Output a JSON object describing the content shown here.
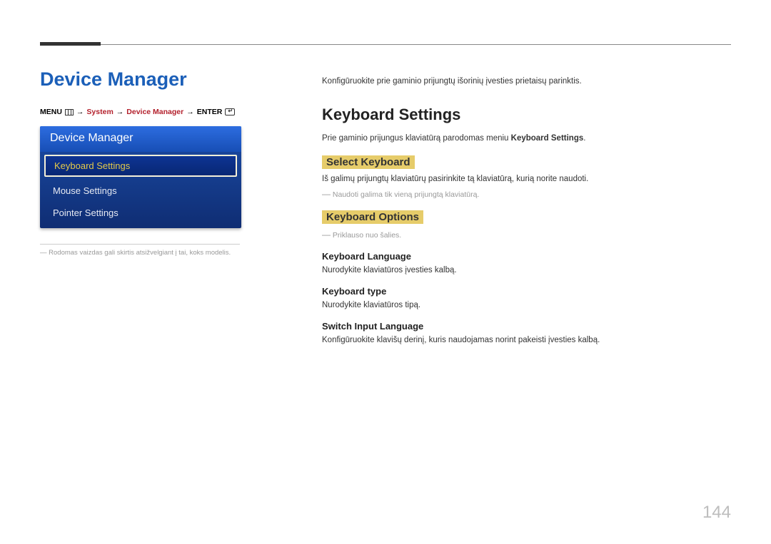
{
  "breadcrumb": {
    "menu": "MENU",
    "arrow": "→",
    "system": "System",
    "device_manager": "Device Manager",
    "enter": "ENTER"
  },
  "left": {
    "title": "Device Manager",
    "panel_header": "Device Manager",
    "items": [
      {
        "label": "Keyboard Settings",
        "selected": true
      },
      {
        "label": "Mouse Settings",
        "selected": false
      },
      {
        "label": "Pointer Settings",
        "selected": false
      }
    ],
    "footnote": "Rodomas vaizdas gali skirtis atsižvelgiant į tai, koks modelis."
  },
  "right": {
    "intro": "Konfigūruokite prie gaminio prijungtų išorinių įvesties prietaisų parinktis.",
    "h2": "Keyboard Settings",
    "h2_desc_pre": "Prie gaminio prijungus klaviatūrą parodomas meniu ",
    "h2_desc_bold": "Keyboard Settings",
    "h2_desc_post": ".",
    "select_keyboard": {
      "title": "Select Keyboard",
      "body": "Iš galimų prijungtų klaviatūrų pasirinkite tą klaviatūrą, kurią norite naudoti.",
      "note": "Naudoti galima tik vieną prijungtą klaviatūrą."
    },
    "keyboard_options": {
      "title": "Keyboard Options",
      "note": "Priklauso nuo šalies.",
      "lang_h": "Keyboard Language",
      "lang_body": "Nurodykite klaviatūros įvesties kalbą.",
      "type_h": "Keyboard type",
      "type_body": "Nurodykite klaviatūros tipą.",
      "switch_h": "Switch Input Language",
      "switch_body": "Konfigūruokite klavišų derinį, kuris naudojamas norint pakeisti įvesties kalbą."
    }
  },
  "page_number": "144",
  "dash": "―"
}
